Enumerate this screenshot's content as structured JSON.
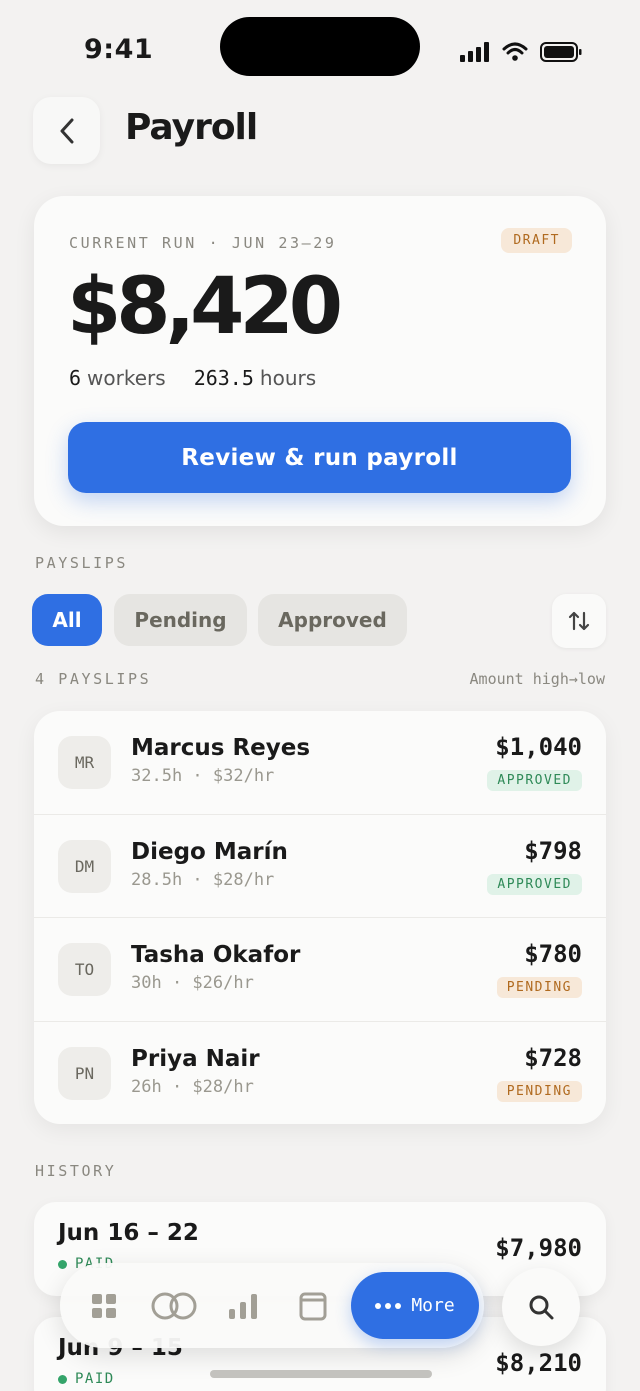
{
  "status_bar": {
    "time": "9:41"
  },
  "header": {
    "title": "Payroll"
  },
  "current_run": {
    "label": "CURRENT RUN · JUN 23–29",
    "badge": "DRAFT",
    "amount": "$8,420",
    "workers_count": "6",
    "workers_label": "workers",
    "hours_count": "263.5",
    "hours_label": "hours",
    "cta": "Review & run payroll"
  },
  "payslips": {
    "section_label": "PAYSLIPS",
    "filters": [
      "All",
      "Pending",
      "Approved"
    ],
    "active_filter": "All",
    "count_label": "4 PAYSLIPS",
    "sort_label": "Amount high→low",
    "rows": [
      {
        "initials": "MR",
        "name": "Marcus Reyes",
        "meta": "32.5h · $32/hr",
        "amount": "$1,040",
        "status": "APPROVED"
      },
      {
        "initials": "DM",
        "name": "Diego Marín",
        "meta": "28.5h · $28/hr",
        "amount": "$798",
        "status": "APPROVED"
      },
      {
        "initials": "TO",
        "name": "Tasha Okafor",
        "meta": "30h · $26/hr",
        "amount": "$780",
        "status": "PENDING"
      },
      {
        "initials": "PN",
        "name": "Priya Nair",
        "meta": "26h · $28/hr",
        "amount": "$728",
        "status": "PENDING"
      }
    ]
  },
  "history": {
    "section_label": "HISTORY",
    "items": [
      {
        "range": "Jun 16 – 22",
        "status": "PAID",
        "amount": "$7,980"
      },
      {
        "range": "Jun 9 – 15",
        "status": "PAID",
        "amount": "$8,210"
      }
    ]
  },
  "tabbar": {
    "icons": [
      "grid-icon",
      "rings-icon",
      "bar-chart-icon",
      "calendar-icon"
    ],
    "more_label": "More"
  },
  "colors": {
    "accent": "#2f6fe3",
    "approved": "#2f8a58",
    "pending": "#b06a1f"
  }
}
